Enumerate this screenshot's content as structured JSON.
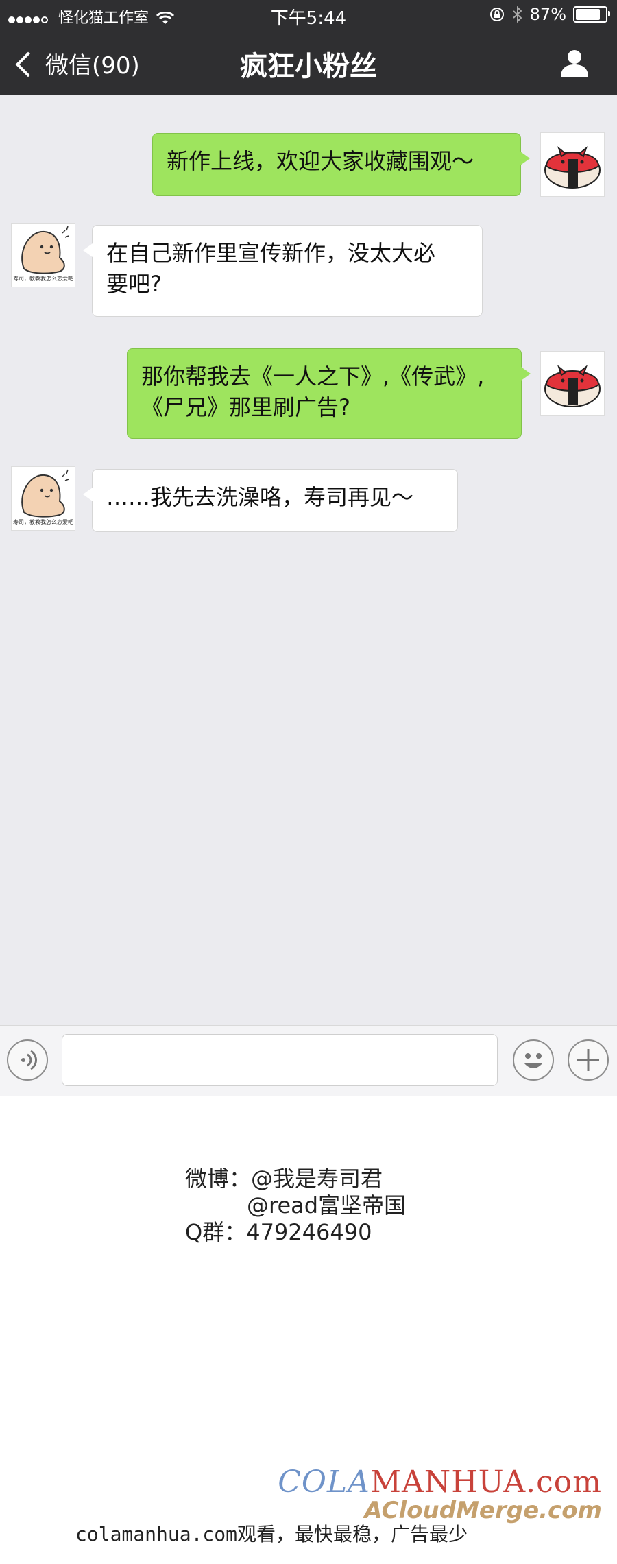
{
  "status_bar": {
    "carrier": "怪化猫工作室",
    "time": "下午5:44",
    "battery": "87%",
    "battery_level": 0.87
  },
  "nav": {
    "back_label": "微信(90)",
    "title": "疯狂小粉丝"
  },
  "avatars": {
    "other_caption": "寿司，教教我怎么恋爱吧"
  },
  "messages": [
    {
      "side": "out",
      "text": "新作上线，欢迎大家收藏围观～"
    },
    {
      "side": "in",
      "line1": "在自己新作里宣传新作，没太大必",
      "line2": "要吧?"
    },
    {
      "side": "out",
      "line1": "那你帮我去《一人之下》,《传武》,",
      "line2": "《尸兄》那里刷广告?"
    },
    {
      "side": "in",
      "text": "……我先去洗澡咯，寿司再见～"
    }
  ],
  "credits": {
    "weibo_label": "微博：",
    "weibo1": "@我是寿司君",
    "weibo2": "@read富坚帝国",
    "qq_label": "Q群：",
    "qq": "479246490"
  },
  "watermark": {
    "line1_a": "COLA",
    "line1_b": "MANHUA.com",
    "line2": "ACloudMerge.com"
  },
  "footer": "colamanhua.com观看，最快最稳，广告最少",
  "colors": {
    "out_bubble": "#9ee45e",
    "in_bubble": "#ffffff",
    "navbar": "#2f2f31",
    "chat_bg": "#ebebef"
  },
  "icons": [
    "signal-dots-icon",
    "wifi-icon",
    "rotation-lock-icon",
    "bluetooth-icon",
    "battery-icon",
    "back-chevron-icon",
    "profile-icon",
    "voice-icon",
    "emoji-icon",
    "plus-icon"
  ]
}
